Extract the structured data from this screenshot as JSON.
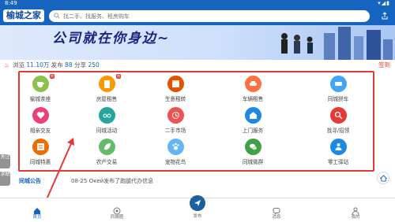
{
  "status": {
    "time": "8:49",
    "system": "▾◢▮"
  },
  "header": {
    "logo": "榆城之家",
    "search_placeholder": "找二手、找服务、租房购车"
  },
  "banner": {
    "slogan": "公司就在你身边~"
  },
  "stats": {
    "viewed_label": "浏览",
    "viewed": "11.10万",
    "posts_label": "发布",
    "posts": "88",
    "share_label": "分享",
    "share": "250",
    "sign": "签到"
  },
  "grid": [
    {
      "label": "榆城茶座",
      "color": "#8bc34a",
      "icon": "teacup-icon",
      "badge": "热"
    },
    {
      "label": "房屋租售",
      "color": "#ff9800",
      "icon": "building-icon",
      "badge": "热"
    },
    {
      "label": "生意租转",
      "color": "#e65100",
      "icon": "shop-icon",
      "badge": ""
    },
    {
      "label": "车辆租售",
      "color": "#ff7043",
      "icon": "car-icon",
      "badge": ""
    },
    {
      "label": "同城拼车",
      "color": "#42a5f5",
      "icon": "van-icon",
      "badge": ""
    },
    {
      "label": "相亲交友",
      "color": "#ec407a",
      "icon": "heart-icon",
      "badge": ""
    },
    {
      "label": "同城活动",
      "color": "#26a69a",
      "icon": "glasses-icon",
      "badge": ""
    },
    {
      "label": "二手市场",
      "color": "#ef5350",
      "icon": "clock-icon",
      "badge": ""
    },
    {
      "label": "上门服务",
      "color": "#1e88e5",
      "icon": "home-icon",
      "badge": ""
    },
    {
      "label": "找寻/招领",
      "color": "#e53935",
      "icon": "search-icon",
      "badge": ""
    },
    {
      "label": "同城特惠",
      "color": "#ef6c00",
      "icon": "news-icon",
      "badge": ""
    },
    {
      "label": "农产交易",
      "color": "#66bb6a",
      "icon": "leaf-icon",
      "badge": ""
    },
    {
      "label": "宠物花鸟",
      "color": "#64b5f6",
      "icon": "paw-icon",
      "badge": ""
    },
    {
      "label": "同城微群",
      "color": "#43a047",
      "icon": "wechat-icon",
      "badge": ""
    },
    {
      "label": "零工驿站",
      "color": "#1e88e5",
      "icon": "worker-icon",
      "badge": ""
    }
  ],
  "notice": {
    "label": "同城公告",
    "text": "08-25 Окей发布了跑腿代办信息"
  },
  "side": {
    "tab1": "关注",
    "tab2": "求助"
  },
  "tabs": [
    {
      "label": "首页",
      "icon": "home-icon"
    },
    {
      "label": "同城圈",
      "icon": "circle-icon"
    },
    {
      "label": "发布",
      "icon": "send-icon"
    },
    {
      "label": "消息",
      "icon": "message-icon"
    },
    {
      "label": "我的",
      "icon": "user-icon"
    }
  ]
}
